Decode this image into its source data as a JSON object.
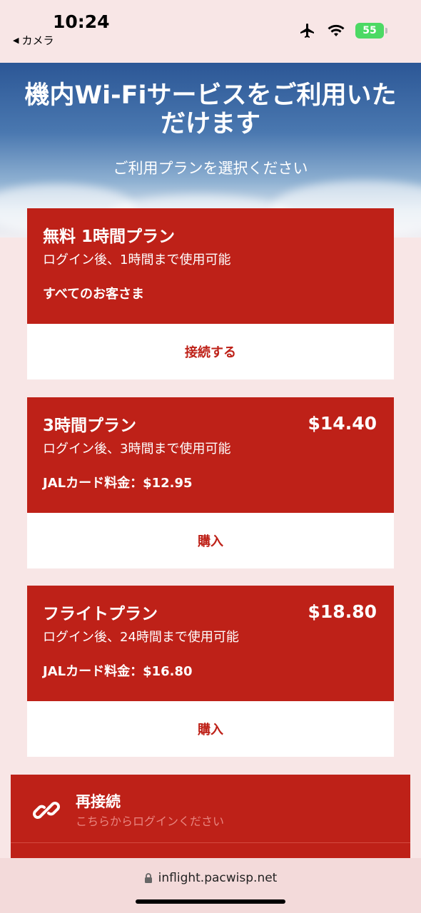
{
  "status_bar": {
    "time": "10:24",
    "back_label": "カメラ",
    "battery": "55"
  },
  "hero": {
    "title": "機内Wi-Fiサービスをご利用いただけます",
    "subtitle": "ご利用プランを選択ください"
  },
  "plans": [
    {
      "name": "無料 1時間プラン",
      "price": "",
      "desc": "ログイン後、1時間まで使用可能",
      "extra": "すべてのお客さま",
      "action": "接続する"
    },
    {
      "name": "3時間プラン",
      "price": "$14.40",
      "desc": "ログイン後、3時間まで使用可能",
      "extra": "JALカード料金：$12.95",
      "action": "購入"
    },
    {
      "name": "フライトプラン",
      "price": "$18.80",
      "desc": "ログイン後、24時間まで使用可能",
      "extra": "JALカード料金：$16.80",
      "action": "購入"
    }
  ],
  "reconnect": {
    "title": "再接続",
    "subtitle": "こちらからログインください"
  },
  "browser": {
    "url": "inflight.pacwisp.net"
  },
  "colors": {
    "accent": "#be2118",
    "page_bg": "#f8e6e6"
  }
}
